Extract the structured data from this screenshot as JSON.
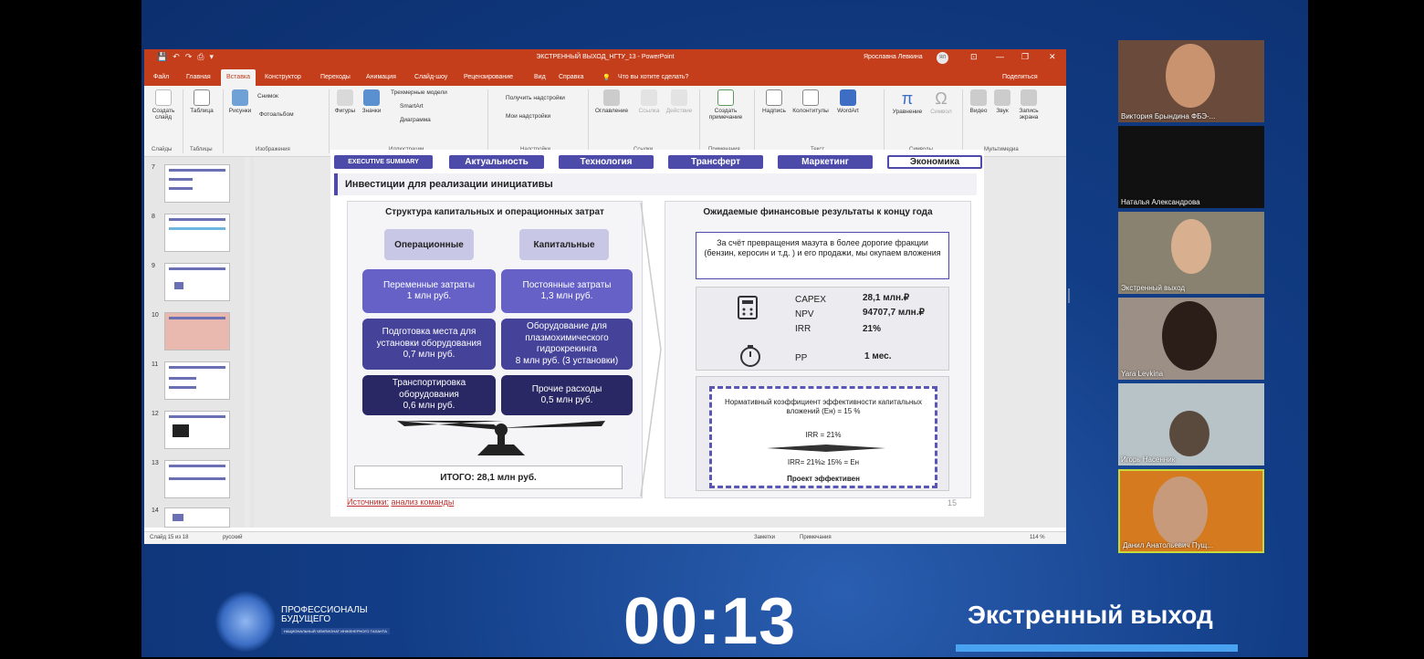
{
  "window": {
    "title": "ЭКСТРЕННЫЙ ВЫХОД_НГТУ_13  -  PowerPoint",
    "user": "Ярославна Левкина",
    "user_initials": "ЯЛ",
    "minimize": "—",
    "restore": "❐",
    "close": "✕"
  },
  "tabs": [
    "Файл",
    "Главная",
    "Вставка",
    "Конструктор",
    "Переходы",
    "Анимация",
    "Слайд-шоу",
    "Рецензирование",
    "Вид",
    "Справка"
  ],
  "tell_me": "Что вы хотите сделать?",
  "share": "Поделиться",
  "ribbon": {
    "create_slide": "Создать слайд",
    "table": "Таблица",
    "pictures": "Рисунки",
    "screenshot": "Снимок",
    "photo_album": "Фотоальбом",
    "shapes": "Фигуры",
    "icons": "Значки",
    "models3d": "Трехмерные модели",
    "smartart": "SmartArt",
    "diagram": "Диаграмма",
    "get_addins": "Получить надстройки",
    "my_addins": "Мои надстройки",
    "toc": "Оглавление",
    "link": "Ссылка",
    "action": "Действие",
    "create_note": "Создать примечание",
    "caption": "Надпись",
    "header_footer": "Колонтитулы",
    "wordart": "WordArt",
    "equation": "Уравнение",
    "symbol": "Символ",
    "video": "Видео",
    "sound": "Звук",
    "screen_rec": "Запись экрана",
    "groups": [
      "Слайды",
      "Таблицы",
      "Изображения",
      "Иллюстрации",
      "Надстройки",
      "Ссылки",
      "Примечания",
      "Текст",
      "Символы",
      "Мультимедиа"
    ]
  },
  "thumbnails": [
    "7",
    "8",
    "9",
    "10",
    "11",
    "12",
    "13",
    "14"
  ],
  "status": {
    "slide": "Слайд 15 из 18",
    "lang": "русский",
    "notes": "Заметки",
    "comments": "Примечания",
    "zoom": "114 %"
  },
  "slide": {
    "nav": [
      "EXECUTIVE SUMMARY",
      "Актуальность",
      "Технология",
      "Трансферт",
      "Маркетинг",
      "Экономика"
    ],
    "heading": "Инвестиции для реализации инициативы",
    "left_title": "Структура капитальных и операционных затрат",
    "col_op": "Операционные",
    "col_cap": "Капитальные",
    "op_items": [
      "Переменные затраты\n1 млн руб.",
      "Подготовка места для установки оборудования\n0,7 млн руб.",
      "Транспортировка оборудования\n0,6 млн руб."
    ],
    "cap_items": [
      "Постоянные затраты\n1,3 млн руб.",
      "Оборудование для плазмохимического гидрокрекинга\n8 млн руб. (3 установки)",
      "Прочие расходы\n0,5 млн руб."
    ],
    "total": "ИТОГО: 28,1 млн руб.",
    "right_title": "Ожидаемые финансовые результаты к концу года",
    "right_text": "За счёт превращения мазута в более дорогие фракции (бензин, керосин и т.д. ) и его продажи, мы окупаем вложения",
    "metrics": [
      {
        "k": "CAPEX",
        "v": "28,1 млн.₽"
      },
      {
        "k": "NPV",
        "v": "94707,7 млн.₽"
      },
      {
        "k": "IRR",
        "v": "21%"
      },
      {
        "k": "PP",
        "v": "1 мес."
      }
    ],
    "eff_line1": "Нормативный коэффициент эффективности капитальных вложений (Ен) = 15 %",
    "eff_line2": "IRR = 21%",
    "eff_line3": "IRR= 21%≥ 15% = Ен",
    "eff_line4": "Проект эффективен",
    "source_label": "Источники:",
    "source_text": "анализ команды",
    "page": "15"
  },
  "participants": [
    "Виктория Брындина ФБЭ-...",
    "Наталья Александрова",
    "Экстренный выход",
    "Yara Levkina",
    "Игорь Насенник",
    "Данил Анатольевич Пущ..."
  ],
  "timer": "00:13",
  "team": "Экстренный выход",
  "logo": {
    "line1": "ПРОФЕССИОНАЛЫ",
    "line2": "БУДУЩЕГО",
    "sub": "НАЦИОНАЛЬНЫЙ ЧЕМПИОНАТ ИНЖЕНЕРНОГО ТАЛАНТА"
  },
  "nav_back": "‹"
}
